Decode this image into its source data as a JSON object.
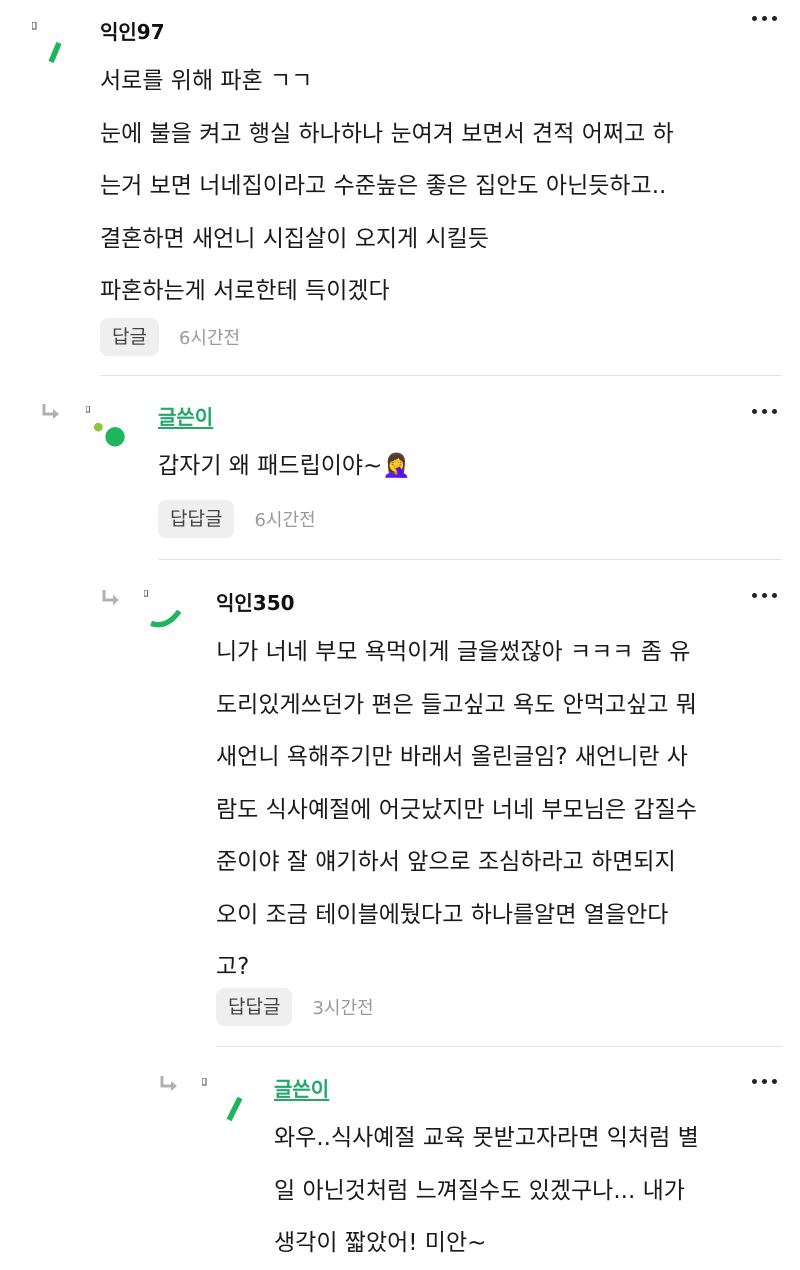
{
  "comments": [
    {
      "nickname": "익인97",
      "lines": [
        "서로를 위해 파혼 ㄱㄱ",
        "눈에 불을 켜고 행실 하나하나 눈여겨 보면서 견적 어쩌고 하",
        "는거 보면 너네집이라고 수준높은 좋은 집안도 아닌듯하고..",
        "결혼하면 새언니 시집살이 오지게 시킬듯",
        "파혼하는게 서로한테 득이겠다"
      ],
      "reply_label": "답글",
      "time": "6시간전",
      "avatar_icon": "green-slash-icon"
    },
    {
      "nickname": "글쓴이",
      "lines": [
        "갑자기 왜 패드립이야~🤦‍♀️"
      ],
      "reply_label": "답답글",
      "time": "6시간전",
      "avatar_icon": "green-dots-icon"
    },
    {
      "nickname": "익인350",
      "lines": [
        "니가 너네 부모 욕먹이게 글을썼잖아 ㅋㅋㅋ 좀 유",
        "도리있게쓰던가 편은 들고싶고 욕도 안먹고싶고 뭐",
        "새언니 욕해주기만 바래서 올린글임? 새언니란 사",
        "람도 식사예절에 어긋났지만 너네 부모님은 갑질수",
        "준이야 잘 얘기하서 앞으로 조심하라고 하면되지",
        "오이 조금 테이블에뒀다고 하나를알면 열을안다",
        "고?"
      ],
      "reply_label": "답답글",
      "time": "3시간전",
      "avatar_icon": "green-arc-icon"
    },
    {
      "nickname": "글쓴이",
      "lines": [
        "와우..식사예절 교육 못받고자라면 익처럼 별",
        "일 아닌것처럼 느껴질수도 있겠구나... 내가",
        "생각이 짧았어! 미안~"
      ],
      "avatar_icon": "green-slash-icon"
    }
  ],
  "colors": {
    "accent": "#22a86a",
    "avatar_green": "#20b45c",
    "avatar_lime": "#8cc63f"
  }
}
